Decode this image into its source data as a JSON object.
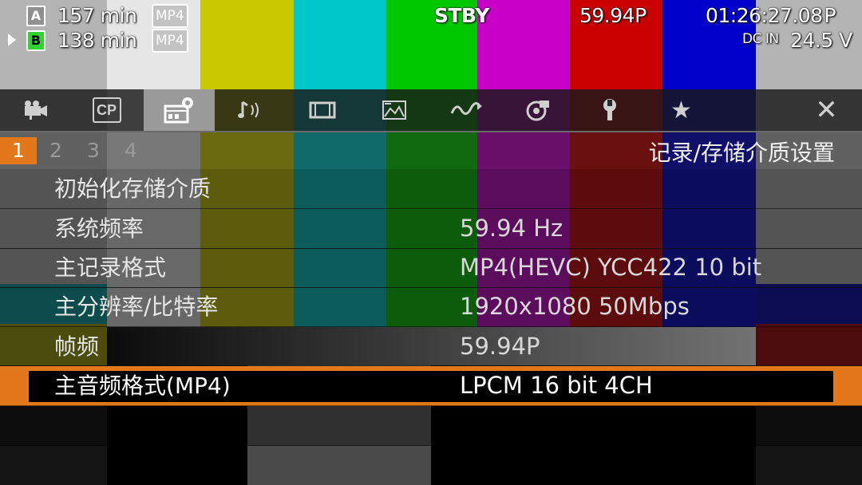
{
  "background": {
    "colors": {
      "gray": "#b4b4b4",
      "white": "#e6e6e6",
      "yellow": "#c8c800",
      "cyan": "#00c8c8",
      "green": "#00c800",
      "magenta": "#c800c8",
      "red": "#c80000",
      "blue": "#0000c8",
      "dark": "#141414",
      "black": "#000000",
      "mid_gray": "#3a3a3a"
    }
  },
  "hud": {
    "slot_a": {
      "letter": "A",
      "time": "157 min",
      "format": "MP4"
    },
    "slot_b": {
      "letter": "B",
      "time": "138 min",
      "format": "MP4"
    },
    "status": "STBY",
    "frame_rate": "59.94P",
    "timecode": "01:26:27.08",
    "timecode_suffix": "P",
    "power_source": "DC IN",
    "voltage": "24.5 V"
  },
  "tabs": [
    {
      "icon": "camera-icon"
    },
    {
      "icon": "cp-icon",
      "label": "CP"
    },
    {
      "icon": "recording-media-settings-icon",
      "active": true
    },
    {
      "icon": "audio-icon"
    },
    {
      "icon": "display-icon"
    },
    {
      "icon": "image-icon"
    },
    {
      "icon": "waveform-icon"
    },
    {
      "icon": "system-icon"
    },
    {
      "icon": "wrench-icon"
    },
    {
      "icon": "star-icon"
    },
    {
      "icon": "close-icon"
    }
  ],
  "pages": [
    "1",
    "2",
    "3",
    "4"
  ],
  "active_page": "1",
  "menu_title": "记录/存储介质设置",
  "accent_color": "#e2781a",
  "rows": [
    {
      "label": "初始化存储介质",
      "value": ""
    },
    {
      "label": "系统频率",
      "value": "59.94 Hz"
    },
    {
      "label": "主记录格式",
      "value": "MP4(HEVC) YCC422 10 bit"
    },
    {
      "label": "主分辨率/比特率",
      "value": "1920x1080 50Mbps"
    },
    {
      "label": "帧频",
      "value": "59.94P"
    },
    {
      "label": "主音频格式(MP4)",
      "value": "LPCM 16 bit 4CH",
      "selected": true
    },
    {
      "label": "",
      "value": ""
    }
  ]
}
